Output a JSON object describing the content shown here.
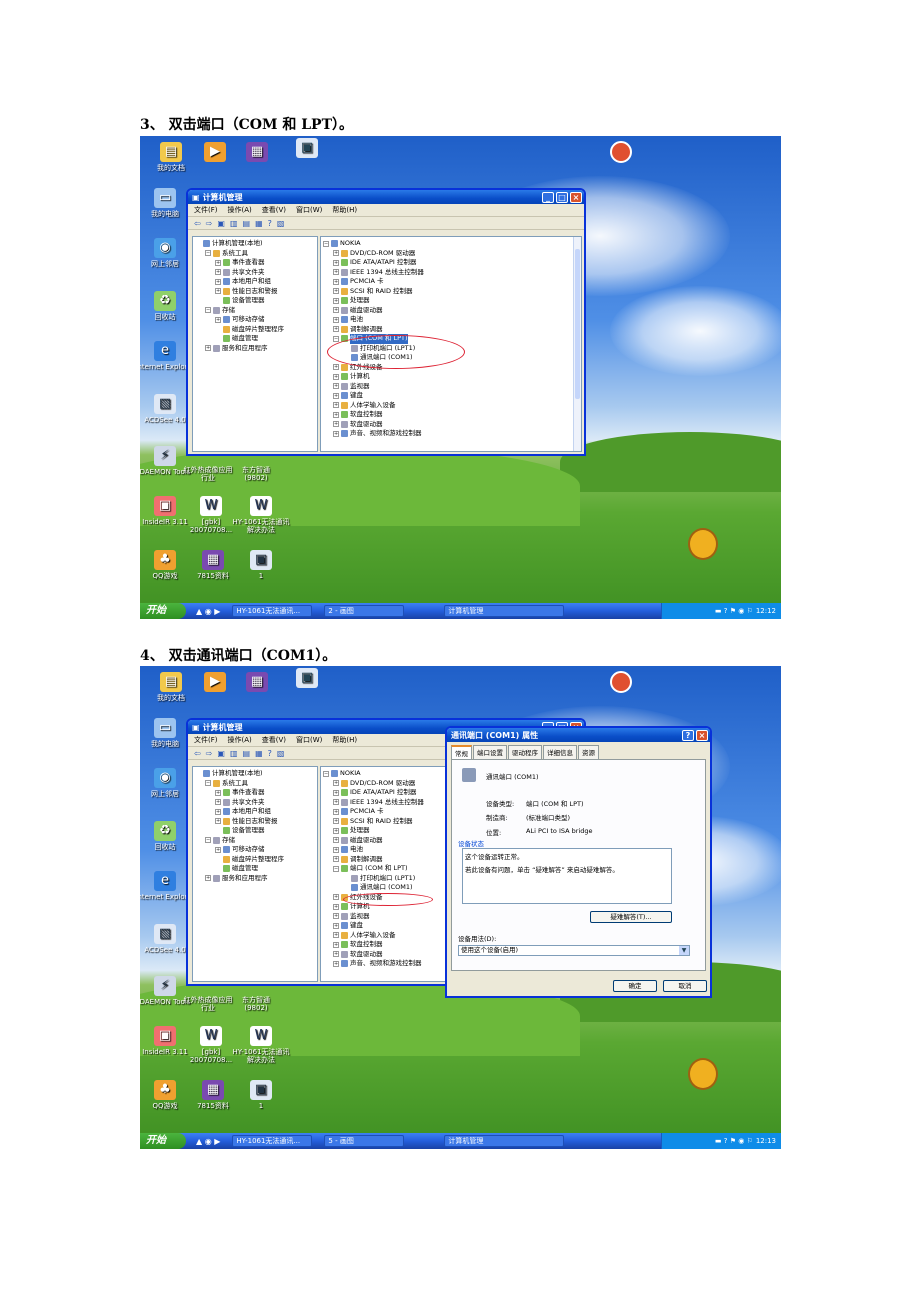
{
  "steps": [
    {
      "heading": "3、 双击端口（COM 和 LPT）。"
    },
    {
      "heading": "4、 双击通讯端口（COM1）。"
    }
  ],
  "desktop_icons": [
    {
      "label": "我的文档",
      "icon": "folder-icon",
      "color": "#f2c94c"
    },
    {
      "label": "我的电脑",
      "icon": "computer-icon",
      "color": "#9cc4f0"
    },
    {
      "label": "网上邻居",
      "icon": "network-icon",
      "color": "#4aa0e8"
    },
    {
      "label": "回收站",
      "icon": "recycle-bin-icon",
      "color": "#8fd06a"
    },
    {
      "label": "Internet Explorer",
      "icon": "ie-icon",
      "color": "#2f7fe0"
    },
    {
      "label": "ACDSee 4.0",
      "icon": "acdsee-icon",
      "color": "#dfe8f5"
    },
    {
      "label": "DAEMON Tools",
      "icon": "daemon-tools-icon",
      "color": "#cfd8e8"
    },
    {
      "label": "InsideIR 3.11",
      "icon": "insideir-icon",
      "color": "#f07070"
    },
    {
      "label": "[gbk] 20070708...",
      "icon": "document-icon",
      "color": "#ffffff"
    },
    {
      "label": "QQ游戏",
      "icon": "qq-game-icon",
      "color": "#f0a030"
    },
    {
      "label": "7815资料",
      "icon": "archive-icon",
      "color": "#7a4ab0"
    },
    {
      "label": "红外热成像应用行业",
      "icon": "",
      "color": ""
    },
    {
      "label": "东方智通 (9802)",
      "icon": "",
      "color": ""
    },
    {
      "label": "HY-1061无法通讯解决办法",
      "icon": "document-icon",
      "color": "#ffffff"
    },
    {
      "label": "1",
      "icon": "calendar-icon",
      "color": "#dfe8f5"
    }
  ],
  "window": {
    "title": "计算机管理",
    "menu": [
      "文件(F)",
      "操作(A)",
      "查看(V)",
      "窗口(W)",
      "帮助(H)"
    ],
    "left_tree": [
      {
        "label": "计算机管理(本地)",
        "level": 0,
        "expander": ""
      },
      {
        "label": "系统工具",
        "level": 1,
        "expander": "−"
      },
      {
        "label": "事件查看器",
        "level": 2,
        "expander": "+"
      },
      {
        "label": "共享文件夹",
        "level": 2,
        "expander": "+"
      },
      {
        "label": "本地用户和组",
        "level": 2,
        "expander": "+"
      },
      {
        "label": "性能日志和警报",
        "level": 2,
        "expander": "+"
      },
      {
        "label": "设备管理器",
        "level": 2,
        "expander": ""
      },
      {
        "label": "存储",
        "level": 1,
        "expander": "−"
      },
      {
        "label": "可移动存储",
        "level": 2,
        "expander": "+"
      },
      {
        "label": "磁盘碎片整理程序",
        "level": 2,
        "expander": ""
      },
      {
        "label": "磁盘管理",
        "level": 2,
        "expander": ""
      },
      {
        "label": "服务和应用程序",
        "level": 1,
        "expander": "+"
      }
    ],
    "device_tree": [
      {
        "label": "NOKIA",
        "level": 0,
        "expander": "−"
      },
      {
        "label": "DVD/CD-ROM 驱动器",
        "level": 1,
        "expander": "+"
      },
      {
        "label": "IDE ATA/ATAPI 控制器",
        "level": 1,
        "expander": "+"
      },
      {
        "label": "IEEE 1394 总线主控制器",
        "level": 1,
        "expander": "+"
      },
      {
        "label": "PCMCIA 卡",
        "level": 1,
        "expander": "+"
      },
      {
        "label": "SCSI 和 RAID 控制器",
        "level": 1,
        "expander": "+"
      },
      {
        "label": "处理器",
        "level": 1,
        "expander": "+"
      },
      {
        "label": "磁盘驱动器",
        "level": 1,
        "expander": "+"
      },
      {
        "label": "电池",
        "level": 1,
        "expander": "+"
      },
      {
        "label": "调制解调器",
        "level": 1,
        "expander": "+"
      },
      {
        "label": "端口 (COM 和 LPT)",
        "level": 1,
        "expander": "−"
      },
      {
        "label": "打印机端口 (LPT1)",
        "level": 2,
        "expander": ""
      },
      {
        "label": "通讯端口 (COM1)",
        "level": 2,
        "expander": ""
      },
      {
        "label": "红外线设备",
        "level": 1,
        "expander": "+"
      },
      {
        "label": "计算机",
        "level": 1,
        "expander": "+"
      },
      {
        "label": "监视器",
        "level": 1,
        "expander": "+"
      },
      {
        "label": "键盘",
        "level": 1,
        "expander": "+"
      },
      {
        "label": "人体学输入设备",
        "level": 1,
        "expander": "+"
      },
      {
        "label": "软盘控制器",
        "level": 1,
        "expander": "+"
      },
      {
        "label": "软盘驱动器",
        "level": 1,
        "expander": "+"
      },
      {
        "label": "声音、视频和游戏控制器",
        "level": 1,
        "expander": "+"
      }
    ]
  },
  "taskbar": {
    "start": "开始",
    "buttons": [
      "HY-1061无法通讯...",
      "画图",
      "计算机管理"
    ],
    "paint_counts": [
      "2",
      "5"
    ],
    "times": [
      "12:12",
      "12:13"
    ]
  },
  "dialog": {
    "title": "通讯端口 (COM1) 属性",
    "tabs": [
      "常规",
      "端口设置",
      "驱动程序",
      "详细信息",
      "资源"
    ],
    "device_name": "通讯端口 (COM1)",
    "fields": [
      {
        "label": "设备类型:",
        "value": "端口 (COM 和 LPT)"
      },
      {
        "label": "制造商:",
        "value": "(标准端口类型)"
      },
      {
        "label": "位置:",
        "value": "ALi PCI to ISA bridge"
      }
    ],
    "status_group": "设备状态",
    "status_lines": [
      "这个设备运转正常。",
      "若此设备有问题，单击 “疑难解答” 来启动疑难解答。"
    ],
    "troubleshoot_button": "疑难解答(T)...",
    "usage_label": "设备用法(D):",
    "usage_value": "使用这个设备(启用)",
    "ok_button": "确定",
    "cancel_button": "取消"
  },
  "colors": {
    "highlight": "#316ac5",
    "annotation": "#dd2233",
    "titlebar": "#0a4ec8"
  }
}
